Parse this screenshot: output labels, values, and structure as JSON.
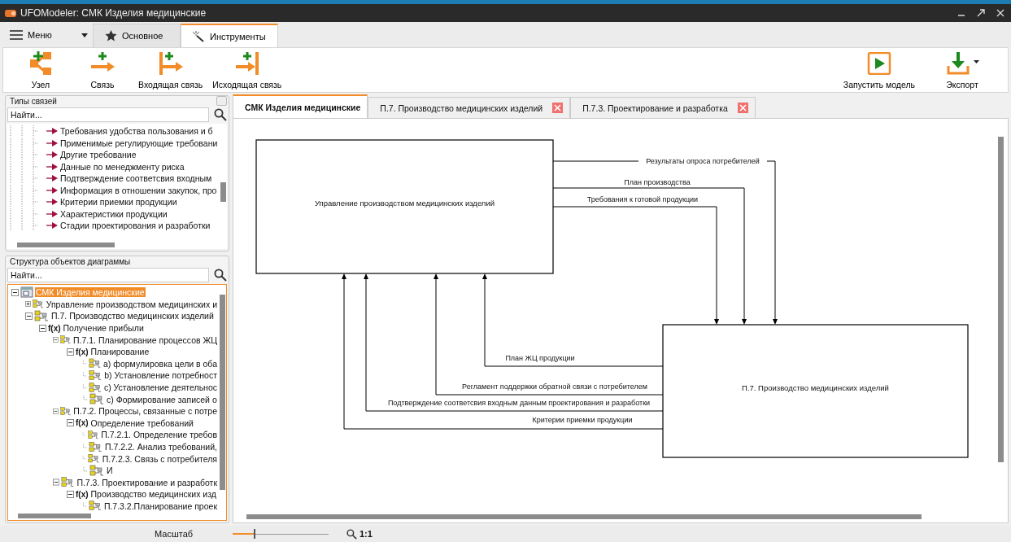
{
  "window": {
    "title": "UFOModeler: СМК Изделия медицинские"
  },
  "menu_button": {
    "label": "Меню"
  },
  "ribbon_tabs": [
    {
      "label": "Основное",
      "selected": false
    },
    {
      "label": "Инструменты",
      "selected": true
    }
  ],
  "ribbon_buttons": [
    {
      "label": "Узел"
    },
    {
      "label": "Связь"
    },
    {
      "label": "Входящая связь"
    },
    {
      "label": "Исходящая связь"
    }
  ],
  "ribbon_right_buttons": [
    {
      "label": "Запустить модель"
    },
    {
      "label": "Экспорт"
    }
  ],
  "link_types_panel": {
    "title": "Типы связей",
    "search": {
      "placeholder": "Найти..."
    },
    "items": [
      "Требования удобства пользования и б",
      "Применимые регулирующие требовани",
      "Другие требование",
      "Данные по менеджменту риска",
      "Подтверждение соответсвия входным",
      "Информация в отношении закупок, про",
      "Критерии приемки продукции",
      "Характеристики продукции",
      "Стадии проектирования и разработки"
    ]
  },
  "structure_panel": {
    "title": "Структура объектов диаграммы",
    "search": {
      "placeholder": "Найти..."
    },
    "tree": [
      {
        "label": "СМК Изделия медицинские",
        "kind": "diagram",
        "selected": true,
        "expanded": true,
        "children": [
          {
            "label": "Управление производством медицинских и",
            "kind": "process",
            "selected": false,
            "expanded": false
          },
          {
            "label": "П.7. Производство медицинских изделий",
            "kind": "process",
            "selected": false,
            "expanded": true,
            "children": [
              {
                "label": "Получение прибыли",
                "kind": "function",
                "badge": "f(x)",
                "selected": false,
                "expanded": true,
                "children": [
                  {
                    "label": "П.7.1. Планирование процессов ЖЦ",
                    "kind": "process",
                    "selected": false,
                    "expanded": true,
                    "children": [
                      {
                        "label": "Планирование",
                        "kind": "function",
                        "badge": "f(x)",
                        "selected": false,
                        "expanded": true,
                        "children": [
                          {
                            "label": "a) формулировка цели в оба",
                            "kind": "process",
                            "selected": false
                          },
                          {
                            "label": "b) Установление потребност",
                            "kind": "process",
                            "selected": false
                          },
                          {
                            "label": "c) Установление деятельнос",
                            "kind": "process",
                            "selected": false
                          },
                          {
                            "label": "c) Формирование записей о",
                            "kind": "process",
                            "selected": false
                          }
                        ]
                      }
                    ]
                  },
                  {
                    "label": "П.7.2. Процессы, связанные с потре",
                    "kind": "process",
                    "selected": false,
                    "expanded": true,
                    "children": [
                      {
                        "label": "Определение требований",
                        "kind": "function",
                        "badge": "f(x)",
                        "selected": false,
                        "expanded": true,
                        "children": [
                          {
                            "label": "П.7.2.1. Определение требов",
                            "kind": "process",
                            "selected": false
                          },
                          {
                            "label": "П.7.2.2. Анализ требований,",
                            "kind": "process",
                            "selected": false
                          },
                          {
                            "label": "П.7.2.3. Связь с потребителя",
                            "kind": "process",
                            "selected": false
                          },
                          {
                            "label": "И",
                            "kind": "process",
                            "selected": false
                          }
                        ]
                      }
                    ]
                  },
                  {
                    "label": "П.7.3. Проектирование и разработк",
                    "kind": "process",
                    "selected": false,
                    "expanded": true,
                    "children": [
                      {
                        "label": "Производство медицинских изд",
                        "kind": "function",
                        "badge": "f(x)",
                        "selected": false,
                        "expanded": true,
                        "children": [
                          {
                            "label": "П.7.3.2.Планирование проек",
                            "kind": "process",
                            "selected": false
                          }
                        ]
                      }
                    ]
                  }
                ]
              }
            ]
          }
        ]
      }
    ]
  },
  "document_tabs": [
    {
      "label": "СМК Изделия медицинские",
      "selected": true,
      "closable": false
    },
    {
      "label": "П.7. Производство медицинских изделий",
      "selected": false,
      "closable": true
    },
    {
      "label": "П.7.3. Проектирование и разработка",
      "selected": false,
      "closable": true
    }
  ],
  "diagram": {
    "nodes": [
      {
        "label": "Управление производством медицинских изделий"
      },
      {
        "label": "П.7. Производство медицинских изделий"
      }
    ],
    "connectors": [
      {
        "label": "Результаты опроса потребителей"
      },
      {
        "label": "План производства"
      },
      {
        "label": "Требования к готовой продукции"
      },
      {
        "label": "План ЖЦ продукции"
      },
      {
        "label": "Регламент поддержки обратной связи с потребителем"
      },
      {
        "label": "Подтверждение соответсвия входным данным проектирования и разработки"
      },
      {
        "label": "Критерии приемки продукции"
      }
    ]
  },
  "status_bar": {
    "zoom_label": "Масштаб",
    "zoom_slider": {
      "level": 0.22
    },
    "ratio": "1:1"
  }
}
